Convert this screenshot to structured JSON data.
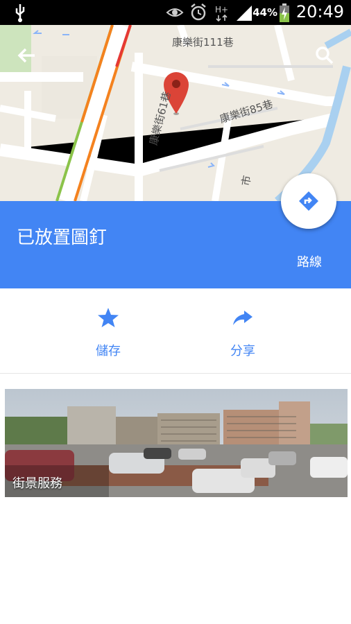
{
  "status_bar": {
    "time": "20:49",
    "battery_percent": "44%",
    "icons": [
      "usb-icon",
      "eye-icon",
      "alarm-icon",
      "hplus-network-icon",
      "signal-icon",
      "battery-charging-icon"
    ]
  },
  "map": {
    "labels": {
      "street_111": "康樂街111巷",
      "street_85": "康樂街85巷",
      "street_61": "康樂街61巷",
      "street_edge": "市"
    },
    "pin_color": "#db4437",
    "road_colors": {
      "traffic_green": "#8bc34a",
      "traffic_orange": "#f4821f",
      "traffic_red": "#e53935",
      "water": "#a9d0f0"
    }
  },
  "header": {
    "title": "已放置圖釘",
    "route_label": "路線",
    "accent": "#4285f4"
  },
  "actions": {
    "save_label": "儲存",
    "share_label": "分享"
  },
  "street_view": {
    "label": "街景服務"
  }
}
